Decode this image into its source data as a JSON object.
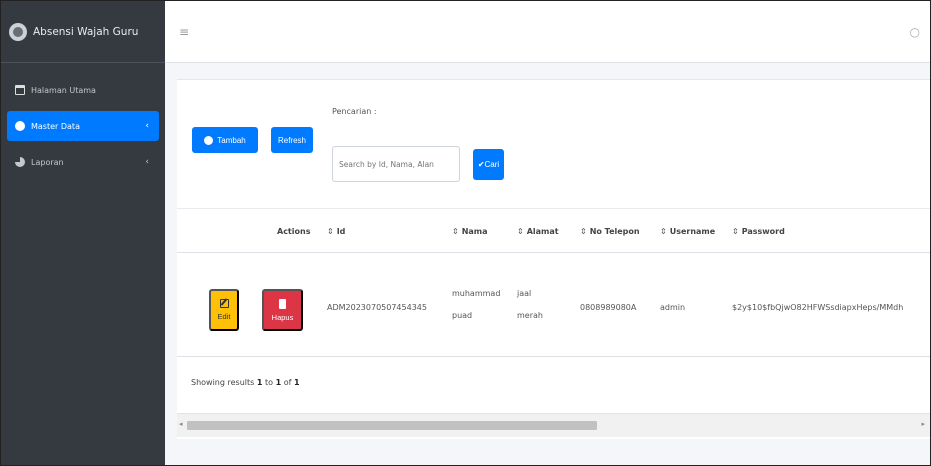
{
  "app": {
    "title": "Absensi Wajah Guru",
    "brand_color": "#343a40",
    "accent": "#007bff"
  },
  "sidebar": {
    "items": [
      {
        "label": "Halaman Utama",
        "icon": "calendar-icon",
        "active": false
      },
      {
        "label": "Master Data",
        "icon": "circle-icon",
        "active": true
      },
      {
        "label": "Laporan",
        "icon": "pie-chart-icon",
        "active": false
      }
    ]
  },
  "topbar": {
    "menu_icon": "hamburger-icon",
    "user_icon": "user-icon"
  },
  "toolbar": {
    "tambah_label": "Tambah",
    "refresh_label": "Refresh",
    "search_label": "Pencarian :",
    "search_placeholder": "Search by Id, Nama, Alan",
    "cari_label": "Cari"
  },
  "table": {
    "headers": [
      "Actions",
      "Id",
      "Nama",
      "Alamat",
      "No Telepon",
      "Username",
      "Password"
    ],
    "rows": [
      {
        "edit_label": "Edit",
        "hapus_label": "Hapus",
        "id": "ADM2023070507454345",
        "nama_line1": "muhammad",
        "nama_line2": "puad",
        "alamat_line1": "jaal",
        "alamat_line2": "merah",
        "no_telepon": "0808989080A",
        "username": "admin",
        "password": "$2y$10$fbQjwO82HFWSsdiapxHeps/MMdh"
      }
    ]
  },
  "footer": {
    "prefix": "Showing results",
    "from": "1",
    "to_word": "to",
    "to": "1",
    "of_word": "of",
    "total": "1"
  },
  "colors": {
    "edit": "#ffc107",
    "hapus": "#dc3545",
    "primary": "#007bff"
  }
}
